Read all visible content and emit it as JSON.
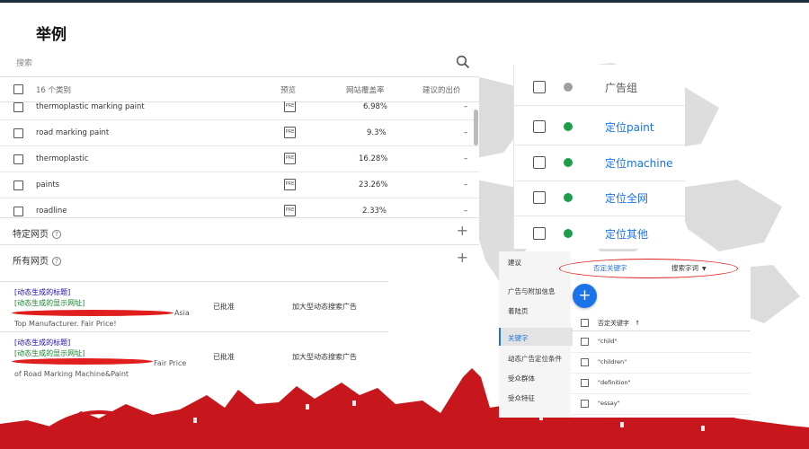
{
  "slide_title": "举例",
  "colors": {
    "brand_red": "#c8161d",
    "accent_blue": "#1a73e8",
    "status_green": "#1e9e4a",
    "status_gray": "#9e9e9e"
  },
  "table": {
    "search_placeholder": "搜索",
    "headers": {
      "categories": "16 个类别",
      "preview": "预览",
      "coverage": "网站覆盖率",
      "bid": "建议的出价"
    },
    "rows": [
      {
        "name": "thermoplastic marking paint",
        "coverage": "6.98%",
        "bid": "–"
      },
      {
        "name": "road marking paint",
        "coverage": "9.3%",
        "bid": "–"
      },
      {
        "name": "thermoplastic",
        "coverage": "16.28%",
        "bid": "–"
      },
      {
        "name": "paints",
        "coverage": "23.26%",
        "bid": "–"
      },
      {
        "name": "roadline",
        "coverage": "2.33%",
        "bid": "–"
      }
    ],
    "sections": [
      {
        "label": "特定网页"
      },
      {
        "label": "所有网页"
      }
    ]
  },
  "ads": [
    {
      "title": "[动态生成的标题]",
      "url": "[动态生成的显示网址]",
      "line3_suffix": "Asia",
      "line4": "Top Manufacturer. Fair Price!",
      "status": "已批准",
      "type": "加大型动态搜索广告"
    },
    {
      "title": "[动态生成的标题]",
      "url": "[动态生成的显示网址]",
      "line3_suffix": "Fair Price",
      "line4": "of Road Marking Machine&Paint",
      "status": "已批准",
      "type": "加大型动态搜索广告"
    }
  ],
  "ad_groups": {
    "header": "广告组",
    "items": [
      {
        "label": "定位paint",
        "status": "enabled"
      },
      {
        "label": "定位machine",
        "status": "enabled"
      },
      {
        "label": "定位全网",
        "status": "enabled"
      },
      {
        "label": "定位其他",
        "status": "enabled"
      }
    ]
  },
  "keyword_panel": {
    "nav": [
      "建议",
      "广告与附加信息",
      "着陆页",
      "关键字",
      "动态广告定位条件",
      "受众群体",
      "受众特征"
    ],
    "selected_nav": "关键字",
    "tabs": {
      "negative": "否定关键字",
      "search_terms": "搜索字词"
    },
    "column_header": "否定关键字",
    "sort_icon": "arrow-up",
    "keywords": [
      "\"child\"",
      "\"children\"",
      "\"definition\"",
      "\"essay\""
    ]
  }
}
